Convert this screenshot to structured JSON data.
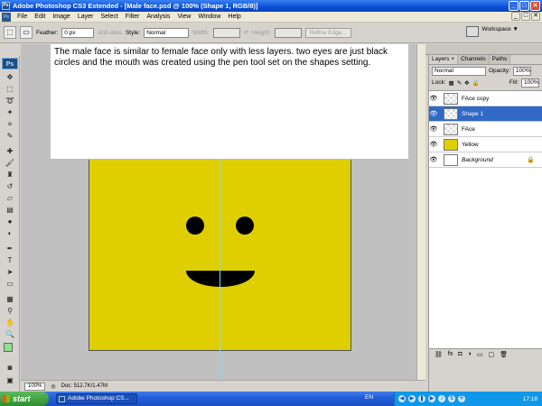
{
  "window": {
    "title": "Adobe Photoshop CS3 Extended - [Male face.psd @ 100% (Shape 1, RGB/8)]",
    "controls": [
      "_",
      "□",
      "✕"
    ]
  },
  "menubar": {
    "logo": "Ps",
    "items": [
      "File",
      "Edit",
      "Image",
      "Layer",
      "Select",
      "Filter",
      "Analysis",
      "View",
      "Window",
      "Help"
    ]
  },
  "options": {
    "feather_label": "Feather:",
    "feather_value": "0 px",
    "antialias_label": "Anti-alias",
    "style_label": "Style:",
    "style_value": "Normal",
    "width_label": "Width:",
    "height_label": "Height:",
    "refine_edge": "Refine Edge...",
    "workspace_label": "Workspace ▼"
  },
  "toolbox": {
    "logo": "Ps",
    "tools": [
      "move-icon",
      "marquee-icon",
      "lasso-icon",
      "magic-wand-icon",
      "crop-icon",
      "slice-icon",
      "healing-icon",
      "brush-icon",
      "clone-stamp-icon",
      "history-brush-icon",
      "eraser-icon",
      "gradient-icon",
      "blur-icon",
      "dodge-icon",
      "pen-icon",
      "type-icon",
      "path-select-icon",
      "shape-icon",
      "notes-icon",
      "eyedropper-icon",
      "hand-icon",
      "zoom-icon"
    ],
    "foreground_color": "#8ee08e",
    "background_color": "#000000"
  },
  "document": {
    "caption": "The male face is similar to female face only with less layers.  two eyes are just black circles and the mouth was created using the pen tool set on the shapes setting.",
    "fill_color": "#e0cf00"
  },
  "statusbar": {
    "zoom": "100%",
    "doc_info": "Doc: 512.7K/1.47M"
  },
  "layers_panel": {
    "tabs": [
      "Layers ×",
      "Channels",
      "Paths"
    ],
    "blend_mode": "Normal",
    "opacity_label": "Opacity:",
    "opacity_value": "100%",
    "lock_label": "Lock:",
    "fill_label": "Fill:",
    "fill_value": "100%",
    "layers": [
      {
        "name": "FAce copy",
        "selected": false
      },
      {
        "name": "Shape 1",
        "selected": true
      },
      {
        "name": "FAce",
        "selected": false
      },
      {
        "name": "Yellow",
        "selected": false
      },
      {
        "name": "Background",
        "selected": false
      }
    ],
    "footer_icons": [
      "link-icon",
      "fx-icon",
      "mask-icon",
      "adjustment-icon",
      "folder-icon",
      "new-layer-icon",
      "trash-icon"
    ]
  },
  "taskbar": {
    "start_label": "start",
    "task_label": "Adobe Photoshop CS...",
    "language": "EN",
    "clock": "17:18"
  }
}
